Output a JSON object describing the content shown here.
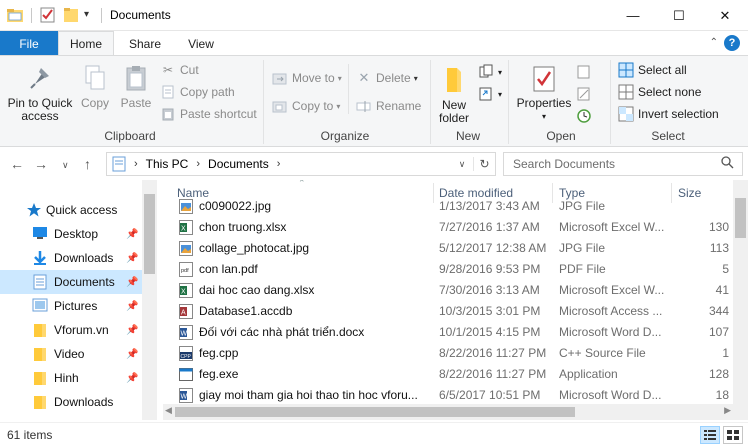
{
  "window": {
    "title": "Documents",
    "minimize_glyph": "—",
    "maximize_glyph": "☐",
    "close_glyph": "✕"
  },
  "tabs": {
    "file": "File",
    "home": "Home",
    "share": "Share",
    "view": "View"
  },
  "ribbon": {
    "clipboard": {
      "label": "Clipboard",
      "pin": "Pin to Quick access",
      "copy": "Copy",
      "paste": "Paste",
      "cut": "Cut",
      "copy_path": "Copy path",
      "paste_shortcut": "Paste shortcut"
    },
    "organize": {
      "label": "Organize",
      "move_to": "Move to",
      "copy_to": "Copy to",
      "delete": "Delete",
      "rename": "Rename"
    },
    "new": {
      "label": "New",
      "new_folder": "New folder"
    },
    "open": {
      "label": "Open",
      "properties": "Properties"
    },
    "select": {
      "label": "Select",
      "select_all": "Select all",
      "select_none": "Select none",
      "invert": "Invert selection"
    }
  },
  "address": {
    "crumbs": [
      "This PC",
      "Documents"
    ],
    "search_placeholder": "Search Documents"
  },
  "nav": {
    "items": [
      {
        "label": "Quick access",
        "icon": "star-icon"
      },
      {
        "label": "Desktop",
        "icon": "desktop-icon",
        "pinned": true
      },
      {
        "label": "Downloads",
        "icon": "download-icon",
        "pinned": true
      },
      {
        "label": "Documents",
        "icon": "documents-icon",
        "pinned": true,
        "selected": true
      },
      {
        "label": "Pictures",
        "icon": "pictures-icon",
        "pinned": true
      },
      {
        "label": "Vforum.vn",
        "icon": "folder-icon",
        "pinned": true
      },
      {
        "label": "Video",
        "icon": "folder-icon",
        "pinned": true
      },
      {
        "label": "Hinh",
        "icon": "folder-icon",
        "pinned": true
      },
      {
        "label": "Downloads",
        "icon": "folder-icon"
      }
    ]
  },
  "filelist": {
    "columns": {
      "name": "Name",
      "date": "Date modified",
      "type": "Type",
      "size": "Size"
    },
    "rows": [
      {
        "name": "c0090022.jpg",
        "date": "1/13/2017 3:43 AM",
        "type": "JPG File",
        "size": "",
        "icon": "jpg"
      },
      {
        "name": "chon truong.xlsx",
        "date": "7/27/2016 1:37 AM",
        "type": "Microsoft Excel W...",
        "size": "130",
        "icon": "xlsx"
      },
      {
        "name": "collage_photocat.jpg",
        "date": "5/12/2017 12:38 AM",
        "type": "JPG File",
        "size": "113",
        "icon": "jpg"
      },
      {
        "name": "con lan.pdf",
        "date": "9/28/2016 9:53 PM",
        "type": "PDF File",
        "size": "5",
        "icon": "pdf"
      },
      {
        "name": "dai hoc cao dang.xlsx",
        "date": "7/30/2016 3:13 AM",
        "type": "Microsoft Excel W...",
        "size": "41",
        "icon": "xlsx"
      },
      {
        "name": "Database1.accdb",
        "date": "10/3/2015 3:01 PM",
        "type": "Microsoft Access ...",
        "size": "344",
        "icon": "accdb"
      },
      {
        "name": "Đối với các nhà phát triển.docx",
        "date": "10/1/2015 4:15 PM",
        "type": "Microsoft Word D...",
        "size": "107",
        "icon": "docx"
      },
      {
        "name": "feg.cpp",
        "date": "8/22/2016 11:27 PM",
        "type": "C++ Source File",
        "size": "1",
        "icon": "cpp"
      },
      {
        "name": "feg.exe",
        "date": "8/22/2016 11:27 PM",
        "type": "Application",
        "size": "128",
        "icon": "exe"
      },
      {
        "name": "giay moi tham gia hoi thao tin hoc vforu...",
        "date": "6/5/2017 10:51 PM",
        "type": "Microsoft Word D...",
        "size": "18",
        "icon": "docx"
      }
    ]
  },
  "status": {
    "count": "61 items"
  },
  "colors": {
    "accent": "#1979ca",
    "selected": "#cce8ff",
    "folder": "#ffd86e"
  }
}
